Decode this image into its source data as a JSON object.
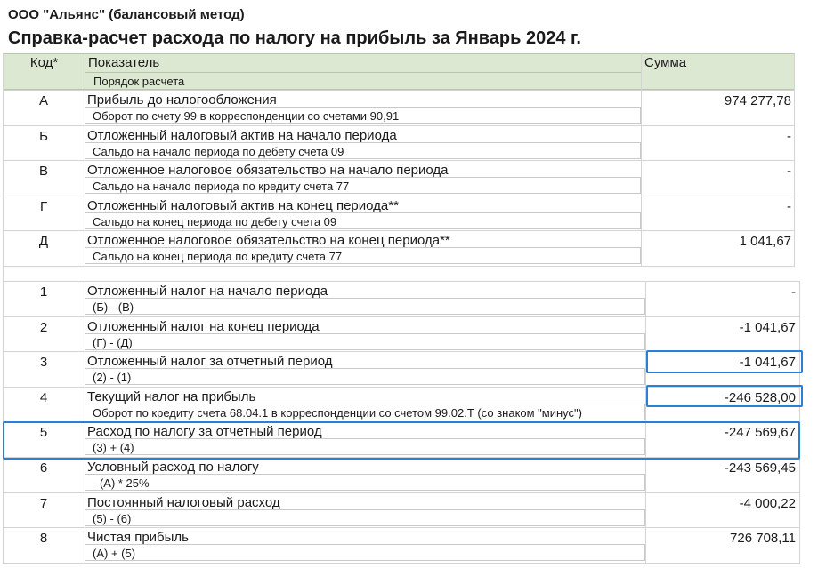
{
  "company": "ООО \"Альянс\" (балансовый метод)",
  "report_title": "Справка-расчет расхода по налогу на прибыль за Январь 2024 г.",
  "header": {
    "code": "Код*",
    "indicator": "Показатель",
    "order": "Порядок расчета",
    "amount": "Сумма"
  },
  "section1": [
    {
      "code": "А",
      "name": "Прибыль до налогообложения",
      "calc": "Оборот по счету 99 в корреспонденции со счетами 90,91",
      "amount": "974 277,78"
    },
    {
      "code": "Б",
      "name": "Отложенный налоговый актив на начало периода",
      "calc": "Сальдо на начало периода по дебету счета 09",
      "amount": "-"
    },
    {
      "code": "В",
      "name": "Отложенное налоговое обязательство на начало периода",
      "calc": "Сальдо на начало периода по кредиту счета 77",
      "amount": "-"
    },
    {
      "code": "Г",
      "name": "Отложенный налоговый актив на конец периода**",
      "calc": "Сальдо на конец периода по дебету счета 09",
      "amount": "-"
    },
    {
      "code": "Д",
      "name": "Отложенное налоговое обязательство на конец периода**",
      "calc": "Сальдо на конец периода по кредиту счета 77",
      "amount": "1 041,67"
    }
  ],
  "section2": [
    {
      "code": "1",
      "name": "Отложенный налог на начало периода",
      "calc": "(Б) - (В)",
      "amount": "-"
    },
    {
      "code": "2",
      "name": "Отложенный налог на конец периода",
      "calc": "(Г) - (Д)",
      "amount": "-1 041,67"
    },
    {
      "code": "3",
      "name": "Отложенный налог за отчетный период",
      "calc": "(2) - (1)",
      "amount": "-1 041,67"
    },
    {
      "code": "4",
      "name": "Текущий налог на прибыль",
      "calc": "Оборот по кредиту счета 68.04.1 в корреспонденции со счетом 99.02.Т (со знаком \"минус\")",
      "amount": "-246 528,00"
    },
    {
      "code": "5",
      "name": "Расход по налогу за отчетный период",
      "calc": "(3) + (4)",
      "amount": "-247 569,67"
    },
    {
      "code": "6",
      "name": "Условный расход по налогу",
      "calc": "- (А) * 25%",
      "amount": "-243 569,45"
    },
    {
      "code": "7",
      "name": "Постоянный налоговый расход",
      "calc": "(5) - (6)",
      "amount": "-4 000,22"
    },
    {
      "code": "8",
      "name": "Чистая прибыль",
      "calc": "(А) + (5)",
      "amount": "726 708,11"
    }
  ]
}
